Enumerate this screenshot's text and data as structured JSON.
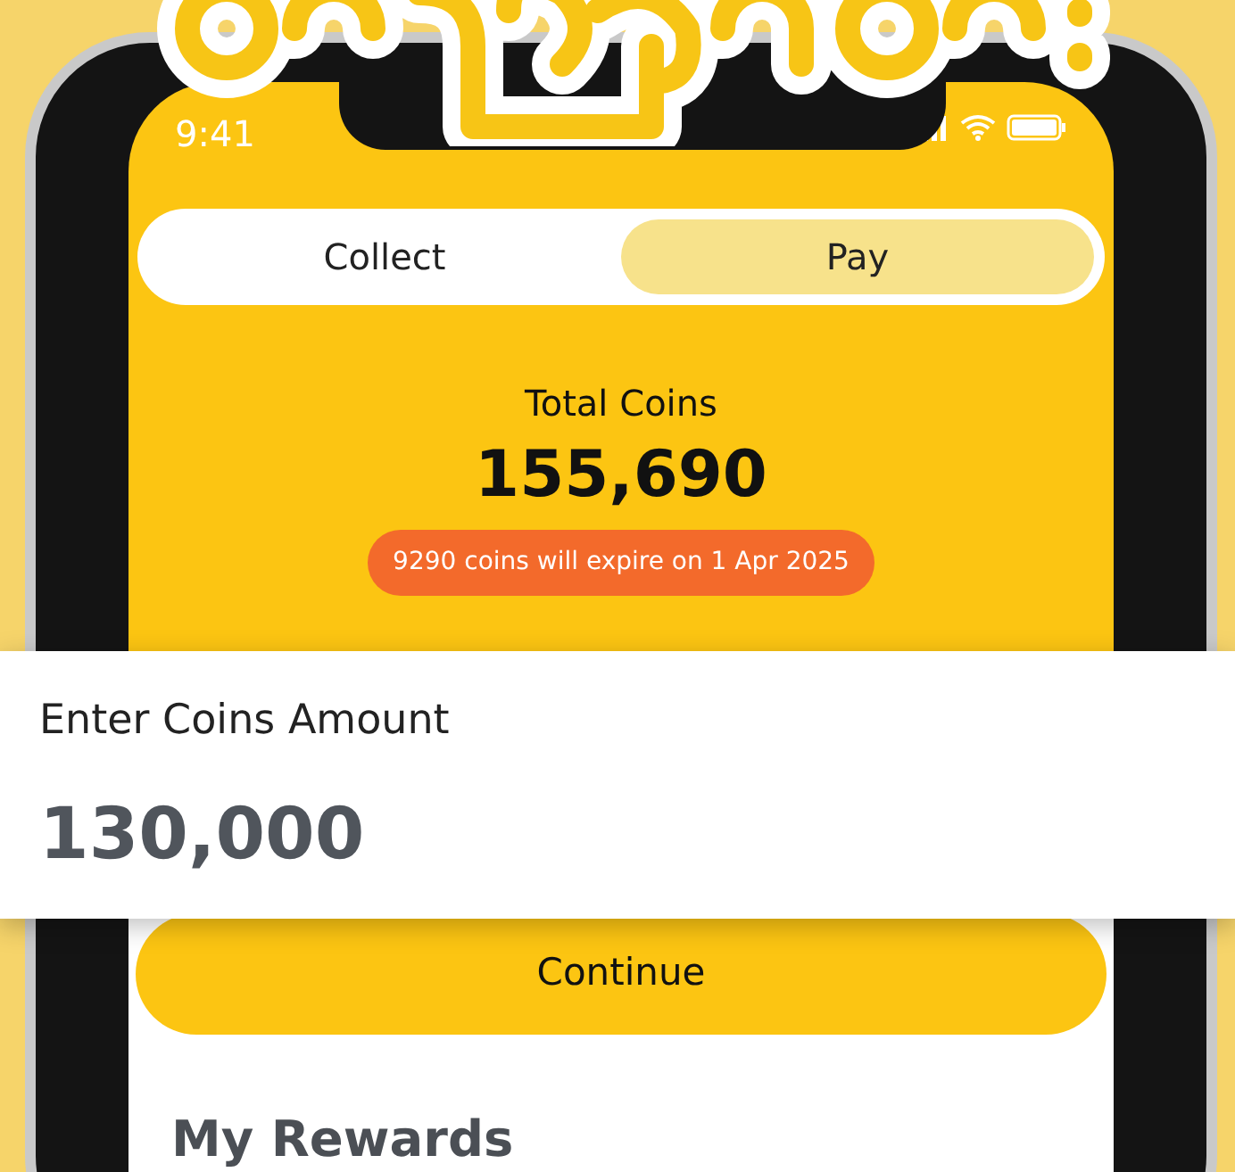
{
  "status_bar": {
    "time": "9:41"
  },
  "mode_toggle": [
    {
      "label": "Collect",
      "selected": false
    },
    {
      "label": "Pay",
      "selected": true
    }
  ],
  "balance": {
    "label": "Total Coins",
    "value": "155,690",
    "expiry_notice": "9290 coins will expire on 1 Apr 2025"
  },
  "amount_card": {
    "label": "Enter Coins Amount",
    "value": "130,000"
  },
  "continue_button": "Continue",
  "rewards": {
    "heading": "My Rewards"
  }
}
